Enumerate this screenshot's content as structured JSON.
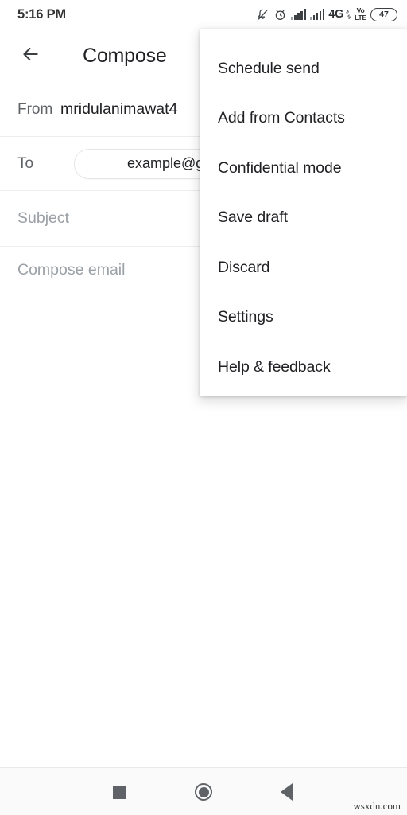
{
  "status_bar": {
    "clock": "5:16 PM",
    "notifications_muted_icon": "bell-muted-icon",
    "alarm_icon": "alarm-clock-icon",
    "signal_1_icon": "signal-bars-icon",
    "signal_2_icon": "signal-bars-icon",
    "network_type": "4G",
    "data_activity": "⇅",
    "volte_top": "Vo",
    "volte_bottom": "LTE",
    "battery_level": "47"
  },
  "app_bar": {
    "back_icon": "arrow-back-icon",
    "title": "Compose"
  },
  "compose": {
    "from_label": "From",
    "from_value": "mridulanimawat4",
    "to_label": "To",
    "to_chip": "example@gm",
    "subject_placeholder": "Subject",
    "body_placeholder": "Compose email"
  },
  "overflow_menu": {
    "items": [
      {
        "label": "Schedule send"
      },
      {
        "label": "Add from Contacts"
      },
      {
        "label": "Confidential mode"
      },
      {
        "label": "Save draft"
      },
      {
        "label": "Discard"
      },
      {
        "label": "Settings"
      },
      {
        "label": "Help & feedback"
      }
    ]
  },
  "nav_bar": {
    "recents_icon": "square-recents-icon",
    "home_icon": "circle-home-icon",
    "back_icon": "triangle-back-icon"
  },
  "watermark": "wsxdn.com",
  "colors": {
    "background": "#ffffff",
    "primary_text": "#202124",
    "secondary_text": "#5f6368",
    "placeholder_text": "#9aa0a6",
    "divider": "#ededed",
    "nav_bar_bg": "#fafafa"
  }
}
